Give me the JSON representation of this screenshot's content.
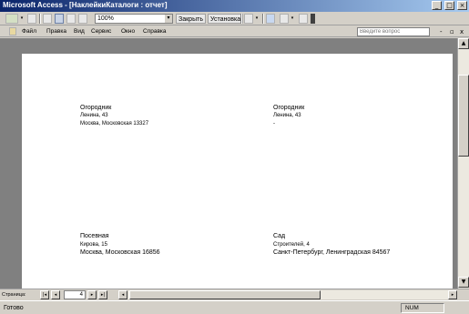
{
  "window": {
    "title": "Microsoft Access - [НаклейкиКаталоги : отчет]",
    "min": "_",
    "max": "□",
    "close": "×"
  },
  "toolbar": {
    "zoom": "100%",
    "setup_label": "Закрыть",
    "view_label": "Установка",
    "dropdown_arrow": "▾"
  },
  "menu": {
    "items": [
      "Файл",
      "Правка",
      "Вид",
      "Сервис",
      "Окно",
      "Справка"
    ],
    "ask_placeholder": "Введите вопрос",
    "mdi_min": "-",
    "mdi_restore": "▫",
    "mdi_close": "x"
  },
  "report": {
    "labels": [
      {
        "name": "Огородник",
        "street": "Ленина, 43",
        "city": "Москва, Московская 13327"
      },
      {
        "name": "Огородник",
        "street": "Ленина, 43",
        "city": "-"
      },
      {
        "name": "Посевная",
        "street": "Кирова, 15",
        "city": "Москва, Московская 16856"
      },
      {
        "name": "Сад",
        "street": "Строителей, 4",
        "city": "Санкт-Петербург, Ленинградская 84567"
      }
    ]
  },
  "nav": {
    "label": "Страница:",
    "page": "4",
    "first": "|◂",
    "prev": "◂",
    "next": "▸",
    "last": "▸|"
  },
  "status": {
    "ready": "Готово",
    "num": "NUM"
  }
}
